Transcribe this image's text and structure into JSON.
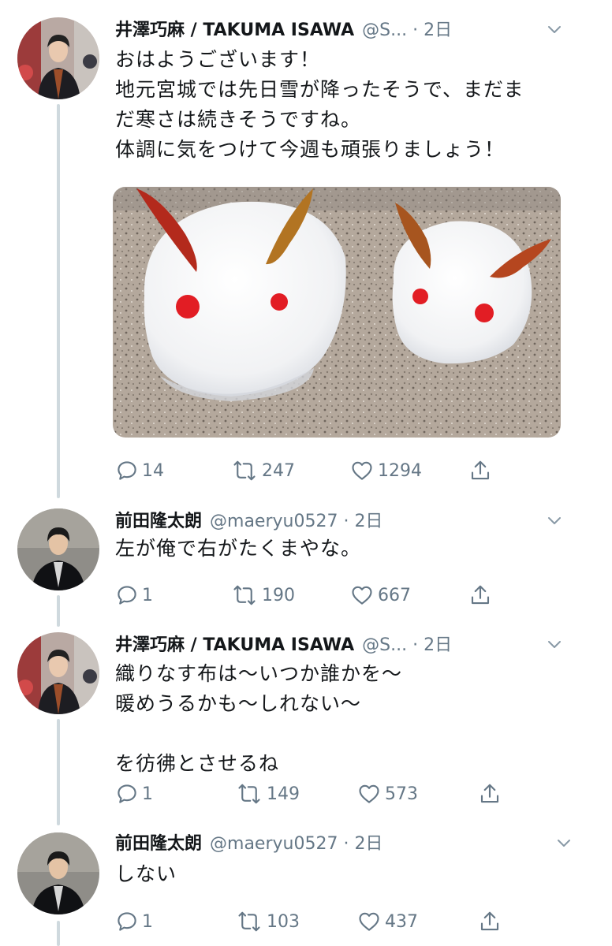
{
  "tweets": [
    {
      "name": "井澤巧麻 / TAKUMA ISAWA",
      "meta": "@S... · 2日",
      "lines": [
        "おはようございます！",
        "地元宮城では先日雪が降ったそうで、まだま",
        "だ寒さは続きそうですね。",
        "体調に気をつけて今週も頑張りましょう！"
      ],
      "replies": "14",
      "retweets": "247",
      "likes": "1294"
    },
    {
      "name": "前田隆太朗",
      "meta": "@maeryu0527 · 2日",
      "lines": [
        "左が俺で右がたくまやな。"
      ],
      "replies": "1",
      "retweets": "190",
      "likes": "667"
    },
    {
      "name": "井澤巧麻 / TAKUMA ISAWA",
      "meta": "@S... · 2日",
      "lines": [
        "織りなす布は〜いつか誰かを〜",
        "暖めうるかも〜しれない〜",
        "",
        "を彷彿とさせるね"
      ],
      "replies": "1",
      "retweets": "149",
      "likes": "573"
    },
    {
      "name": "前田隆太朗",
      "meta": "@maeryu0527 · 2日",
      "lines": [
        "しない"
      ],
      "replies": "1",
      "retweets": "103",
      "likes": "437"
    }
  ],
  "icons": [
    "reply-icon",
    "retweet-icon",
    "like-icon",
    "share-icon",
    "chevron-down-icon"
  ],
  "colors": {
    "text": "#14171a",
    "secondary": "#657786",
    "thread": "#cfd9de"
  }
}
